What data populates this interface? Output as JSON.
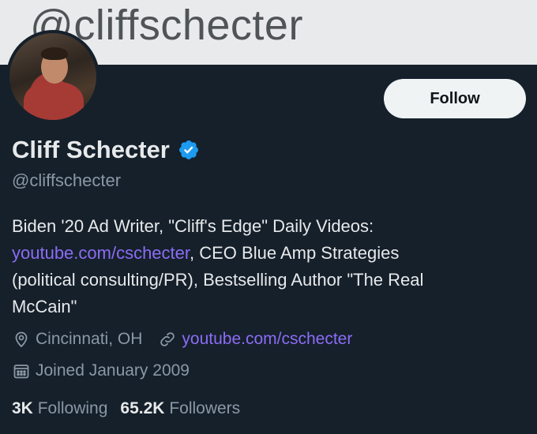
{
  "banner": {
    "text": "@cliffschecter"
  },
  "profile": {
    "name": "Cliff Schecter",
    "handle": "@cliffschecter",
    "verified": true,
    "follow_label": "Follow",
    "bio": {
      "line1": "Biden '20 Ad Writer, \"Cliff's Edge\" Daily Videos:",
      "link": "youtube.com/cschecter",
      "after_link": ", CEO Blue Amp Strategies",
      "line3": "(political consulting/PR), Bestselling Author \"The Real",
      "line4": "McCain\""
    },
    "location": "Cincinnati, OH",
    "website": "youtube.com/cschecter",
    "joined": "Joined January 2009",
    "following_count": "3K",
    "following_label": "Following",
    "followers_count": "65.2K",
    "followers_label": "Followers"
  },
  "colors": {
    "background": "#15202b",
    "link": "#8c6cf5",
    "muted": "#8b98a5",
    "verified": "#1d9bf0"
  },
  "icons": [
    "verified-badge-icon",
    "location-pin-icon",
    "link-icon",
    "calendar-icon"
  ]
}
